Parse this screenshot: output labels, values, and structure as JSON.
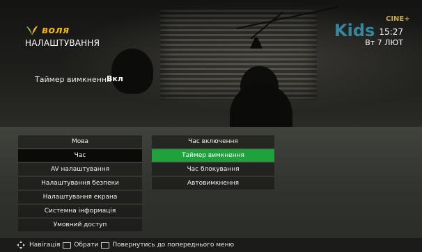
{
  "header": {
    "brand": "воля",
    "title": "НАЛАШТУВАННЯ",
    "time": "15:27",
    "date": "Вт 7 ЛЮТ",
    "channel_logo": "Kids",
    "channel_logo_sup": "CINE+"
  },
  "setting": {
    "label": "Таймер вимкнення",
    "value": "Вкл"
  },
  "menu_left": [
    {
      "label": "Мова"
    },
    {
      "label": "Час"
    },
    {
      "label": "AV налаштування"
    },
    {
      "label": "Налаштування безпеки"
    },
    {
      "label": "Налаштування екрана"
    },
    {
      "label": "Системна інформація"
    },
    {
      "label": "Умовний доступ"
    }
  ],
  "menu_right": [
    {
      "label": "Час включення"
    },
    {
      "label": "Таймер вимкнення"
    },
    {
      "label": "Час блокування"
    },
    {
      "label": "Автовимкнення"
    }
  ],
  "footer": {
    "nav_label": "Навігація",
    "select_label": "Обрати",
    "back_label": "Повернутись до попереднього меню"
  },
  "colors": {
    "brand": "#f0b21c",
    "selected_green": "#1fa23c"
  }
}
